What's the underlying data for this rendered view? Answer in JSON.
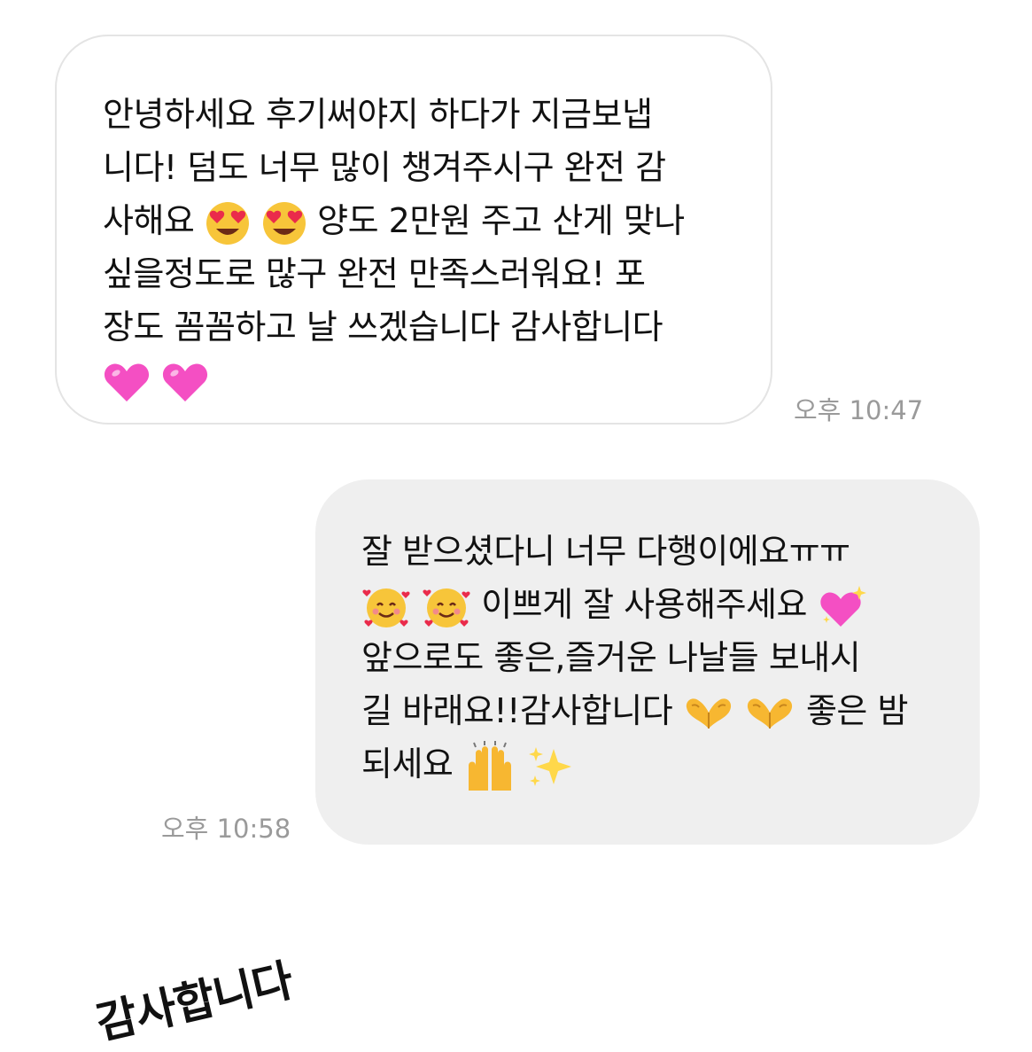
{
  "incoming_message": {
    "lines": [
      "안녕하세요 후기써야지 하다가 지금보냅",
      "니다! 덤도 너무 많이 챙겨주시구 완전 감",
      "사해요",
      "양도 2만원 주고 산게 맞나",
      " 싶을정도로 많구 완전 만족스러워요! 포",
      "장도 꼼꼼하고 날 쓰겠습니다 감사합니다"
    ],
    "emojis": {
      "heart_eyes": "heart-eyes-emoji",
      "pink_heart": "pink-heart-emoji"
    },
    "time": "오후 10:47"
  },
  "outgoing_message": {
    "lines": [
      "잘 받으셨다니 너무 다행이에요ㅠㅠ",
      "이쁘게 잘 사용해주세요",
      "앞으로도 좋은,즐거운 나날들 보내시",
      "길 바래요!!감사합니다",
      "좋은 밤",
      "되세요"
    ],
    "emojis": {
      "smiling_hearts": "smiling-face-with-hearts-emoji",
      "sparkling_heart": "sparkling-heart-emoji",
      "heart_hands": "heart-hands-emoji",
      "raising_hands": "raising-hands-emoji",
      "sparkles": "sparkles-emoji"
    },
    "time": "오후 10:58"
  },
  "sticker": {
    "text": "감사합니다"
  },
  "colors": {
    "incoming_bubble": "#ffffff",
    "incoming_border": "#e4e4e4",
    "outgoing_bubble": "#efefef",
    "text": "#111111",
    "timestamp": "#9a9a9a",
    "emoji_yellow": "#f7c53a",
    "emoji_pink_heart": "#f44fc3"
  }
}
